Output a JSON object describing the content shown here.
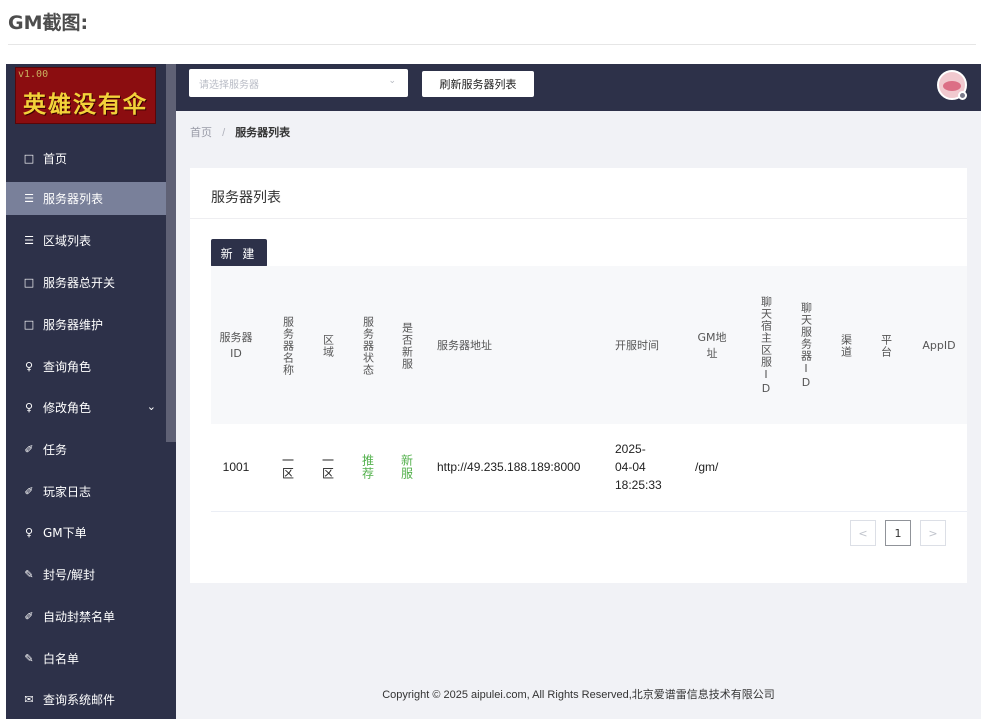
{
  "article": {
    "heading": "GM截图:"
  },
  "app": {
    "logo": {
      "version": "v1.00",
      "title": "英雄没有伞"
    }
  },
  "sidebar": {
    "items": [
      {
        "label": "首页",
        "icon": "□"
      },
      {
        "label": "服务器列表",
        "icon": "☰",
        "active": true
      },
      {
        "label": "区域列表",
        "icon": "☰"
      },
      {
        "label": "服务器总开关",
        "icon": "□"
      },
      {
        "label": "服务器维护",
        "icon": "□"
      },
      {
        "label": "查询角色",
        "icon": "♀"
      },
      {
        "label": "修改角色",
        "icon": "♀",
        "chevron": "⌄"
      },
      {
        "label": "任务",
        "icon": "✐"
      },
      {
        "label": "玩家日志",
        "icon": "✐"
      },
      {
        "label": "GM下单",
        "icon": "♀"
      },
      {
        "label": "封号/解封",
        "icon": "✎"
      },
      {
        "label": "自动封禁名单",
        "icon": "✐"
      },
      {
        "label": "白名单",
        "icon": "✎"
      },
      {
        "label": "查询系统邮件",
        "icon": "✉"
      }
    ]
  },
  "topbar": {
    "server_select_placeholder": "请选择服务器",
    "select_caret": "⌄",
    "refresh_button": "刷新服务器列表"
  },
  "breadcrumb": {
    "home": "首页",
    "separator": "/",
    "current": "服务器列表"
  },
  "card": {
    "title": "服务器列表",
    "create_button": "新 建"
  },
  "table": {
    "headers": [
      "服务器ID",
      "服务器名称",
      "区域",
      "服务器状态",
      "是否新服",
      "服务器地址",
      "开服时间",
      "GM地址",
      "聊天宿主区服ID",
      "聊天服务器ID",
      "渠道",
      "平台",
      "AppID"
    ],
    "rows": [
      {
        "id": "1001",
        "name": "一区",
        "region": "一区",
        "status": "推荐",
        "is_new": "新服",
        "address": "http://49.235.188.189:8000",
        "open_time": [
          "2025-",
          "04-04",
          "18:25:33"
        ],
        "gm_address": "/gm/",
        "chat_host_id": "",
        "chat_server_id": "",
        "channel": "",
        "platform": "",
        "app_id": ""
      }
    ]
  },
  "pagination": {
    "prev": "<",
    "current": "1",
    "next": ">"
  },
  "footer": {
    "copyright": "Copyright © 2025 aipulei.com, All Rights Reserved,北京爱谱雷信息技术有限公司"
  },
  "colors": {
    "sidebar_bg": "#2d3149",
    "active_item_bg": "#79809a",
    "logo_bg": "#8b0d10",
    "logo_text": "#f3d23a",
    "status_green": "#52b04b"
  }
}
